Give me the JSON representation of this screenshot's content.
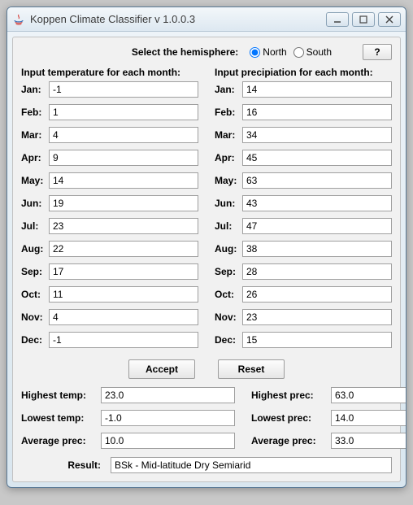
{
  "window": {
    "title": "Koppen Climate Classifier v 1.0.0.3"
  },
  "hemisphere": {
    "label": "Select the hemisphere:",
    "options": {
      "north": "North",
      "south": "South"
    },
    "selected": "north",
    "help": "?"
  },
  "temperature": {
    "header": "Input temperature for each month:",
    "months": {
      "Jan": "-1",
      "Feb": "1",
      "Mar": "4",
      "Apr": "9",
      "May": "14",
      "Jun": "19",
      "Jul": "23",
      "Aug": "22",
      "Sep": "17",
      "Oct": "11",
      "Nov": "4",
      "Dec": "-1"
    }
  },
  "precipitation": {
    "header": "Input precipiation for each month:",
    "months": {
      "Jan": "14",
      "Feb": "16",
      "Mar": "34",
      "Apr": "45",
      "May": "63",
      "Jun": "43",
      "Jul": "47",
      "Aug": "38",
      "Sep": "28",
      "Oct": "26",
      "Nov": "23",
      "Dec": "15"
    }
  },
  "month_labels": {
    "Jan": "Jan:",
    "Feb": "Feb:",
    "Mar": "Mar:",
    "Apr": "Apr:",
    "May": "May:",
    "Jun": "Jun:",
    "Jul": "Jul:",
    "Aug": "Aug:",
    "Sep": "Sep:",
    "Oct": "Oct:",
    "Nov": "Nov:",
    "Dec": "Dec:"
  },
  "buttons": {
    "accept": "Accept",
    "reset": "Reset"
  },
  "stats": {
    "temp": {
      "highest_label": "Highest temp:",
      "highest_value": "23.0",
      "lowest_label": "Lowest temp:",
      "lowest_value": "-1.0",
      "average_label": "Average prec:",
      "average_value": "10.0"
    },
    "prec": {
      "highest_label": "Highest prec:",
      "highest_value": "63.0",
      "lowest_label": "Lowest prec:",
      "lowest_value": "14.0",
      "average_label": "Average prec:",
      "average_value": "33.0"
    }
  },
  "result": {
    "label": "Result:",
    "value": "BSk - Mid-latitude Dry Semiarid"
  }
}
